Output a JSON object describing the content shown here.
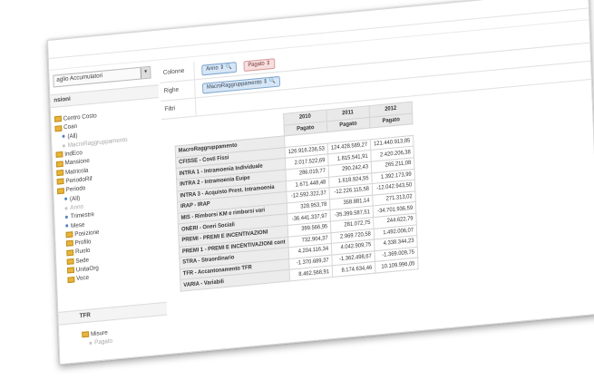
{
  "left_panel": {
    "accumulator_select": "aglio Accumulatori",
    "dimensions_header": "nsioni",
    "tree": [
      {
        "label": "Centro Costo",
        "kind": "folder",
        "level": 1
      },
      {
        "label": "Coan",
        "kind": "folder",
        "level": 1
      },
      {
        "label": "(All)",
        "kind": "bullet",
        "level": 2
      },
      {
        "label": "MacroRaggruppamento",
        "kind": "bullet-faded",
        "level": 2
      },
      {
        "label": "IndEco",
        "kind": "folder",
        "level": 1
      },
      {
        "label": "Mansione",
        "kind": "folder",
        "level": 1
      },
      {
        "label": "Matricola",
        "kind": "folder",
        "level": 1
      },
      {
        "label": "PeriodoRif",
        "kind": "folder",
        "level": 1
      },
      {
        "label": "Periodo",
        "kind": "folder",
        "level": 1
      },
      {
        "label": "(All)",
        "kind": "bullet",
        "level": 2
      },
      {
        "label": "Anno",
        "kind": "bullet-faded",
        "level": 2
      },
      {
        "label": "Trimestre",
        "kind": "bullet",
        "level": 2
      },
      {
        "label": "Mese",
        "kind": "bullet",
        "level": 2
      },
      {
        "label": "Posizione",
        "kind": "folder",
        "level": 2
      },
      {
        "label": "Profilo",
        "kind": "folder",
        "level": 2
      },
      {
        "label": "Ruolo",
        "kind": "folder",
        "level": 2
      },
      {
        "label": "Sede",
        "kind": "folder",
        "level": 2
      },
      {
        "label": "UnitaOrg",
        "kind": "folder",
        "level": 2
      },
      {
        "label": "Voce",
        "kind": "folder",
        "level": 2
      }
    ],
    "tfr_header": "TFR",
    "misure": {
      "label": "Misure",
      "child": "Pagato"
    }
  },
  "zones": {
    "columns_label": "Colonne",
    "rows_label": "Righe",
    "filters_label": "Filtri",
    "column_chips": [
      "Anno ⇕ 🔍",
      "Pagato ⇕"
    ],
    "row_chips": [
      "MacroRaggruppamento ⇕ 🔍"
    ]
  },
  "pivot": {
    "years": [
      "2010",
      "2011",
      "2012"
    ],
    "measure": "Pagato",
    "row_header": "MacroRaggruppamento",
    "rows": [
      {
        "label": "CFISSE - Costi Fissi",
        "values": [
          "126.916.236,53",
          "124.428.589,27",
          "121.440.913,85"
        ]
      },
      {
        "label": "INTRA 1 - Intramoenia Individuale",
        "values": [
          "2.017.522,69",
          "1.815.541,91",
          "2.420.206,38"
        ]
      },
      {
        "label": "INTRA 2 - Intramoenia Euipe",
        "values": [
          "286.019,77",
          "290.242,43",
          "265.211,08"
        ]
      },
      {
        "label": "INTRA 3 - Acquisto Prest. Intramoenia",
        "values": [
          "1.671.448,48",
          "1.618.924,55",
          "1.392.173,99"
        ]
      },
      {
        "label": "IRAP - IRAP",
        "values": [
          "-12.592.322,37",
          "-12.226.115,58",
          "-12.042.943,50"
        ]
      },
      {
        "label": "MIS - Rimborsi KM e rimborsi vari",
        "values": [
          "328.953,78",
          "358.881,14",
          "271.313,02"
        ]
      },
      {
        "label": "ONERI - Oneri Sociali",
        "values": [
          "-36.441.337,97",
          "-35.399.587,51",
          "-34.701.936,59"
        ]
      },
      {
        "label": "PREMI - PREMI E INCENTIVAZIONI",
        "values": [
          "399.566,95",
          "281.072,75",
          "244.622,79"
        ]
      },
      {
        "label": "PREMI 1 - PREMI E INCENTIVAZIONI cont",
        "values": [
          "732.904,37",
          "2.969.720,58",
          "1.492.006,07"
        ]
      },
      {
        "label": "STRA - Straordinario",
        "values": [
          "4.204.116,34",
          "4.042.909,75",
          "4.338.344,23"
        ]
      },
      {
        "label": "TFR - Accantonamento TFR",
        "values": [
          "-1.370.689,37",
          "-1.362.498,67",
          "-1.369.009,75"
        ]
      },
      {
        "label": "VARIA - Variabili",
        "values": [
          "8.462.568,91",
          "8.174.634,46",
          "10.109.996,05"
        ]
      }
    ]
  }
}
